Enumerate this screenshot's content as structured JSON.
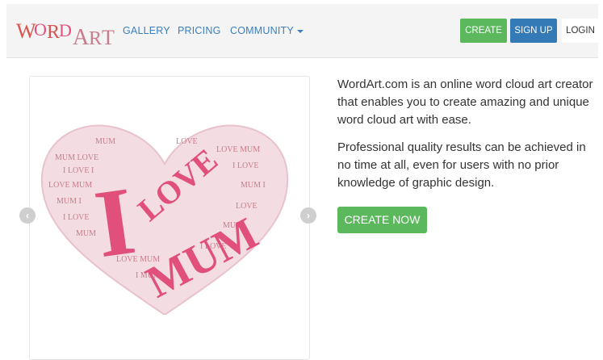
{
  "header": {
    "logo_text": "WORDART",
    "nav": {
      "gallery": "GALLERY",
      "pricing": "PRICING",
      "community": "COMMUNITY"
    },
    "buttons": {
      "create": "CREATE",
      "signup": "SIGN UP",
      "login": "LOGIN"
    }
  },
  "slider": {
    "words": {
      "i": "I",
      "love": "LOVE",
      "mum": "MUM"
    },
    "icons": {
      "prev": "chevron-left-icon",
      "next": "chevron-right-icon"
    }
  },
  "main": {
    "paragraph1": "WordArt.com is an online word cloud art creator that enables you to create amazing and unique word cloud art with ease.",
    "paragraph2": "Professional quality results can be achieved in no time at all, even for users with no prior knowledge of graphic design.",
    "cta_label": "CREATE NOW"
  },
  "colors": {
    "accent_green": "#5cb85c",
    "accent_blue": "#337ab7",
    "link_blue": "#3a7fbf",
    "heart_pink": "#e0507a",
    "heart_rose": "#c97d8c"
  }
}
